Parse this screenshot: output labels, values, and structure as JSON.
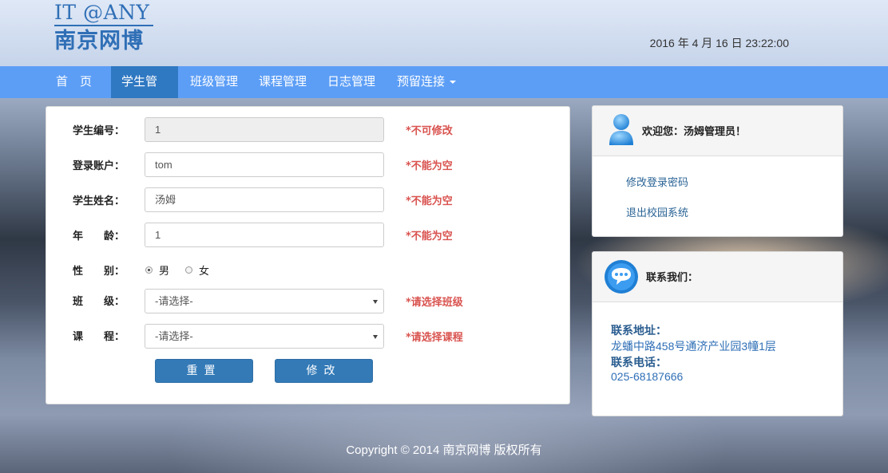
{
  "header": {
    "logo_top": "IT @ANY",
    "logo_bottom": "南京网博",
    "datetime": "2016 年 4 月 16 日 23:22:00"
  },
  "nav": {
    "items": [
      {
        "label": "首　页"
      },
      {
        "label": "学生管理"
      },
      {
        "label": "班级管理"
      },
      {
        "label": "课程管理"
      },
      {
        "label": "日志管理"
      },
      {
        "label": "预留连接"
      }
    ],
    "active": "学生管理"
  },
  "form": {
    "fields": [
      {
        "label": "学生编号：",
        "value": "1",
        "hint": "*不可修改"
      },
      {
        "label": "登录账户：",
        "value": "tom",
        "hint": "*不能为空"
      },
      {
        "label": "学生姓名：",
        "value": "汤姆",
        "hint": "*不能为空"
      },
      {
        "label": "年　　龄：",
        "value": "1",
        "hint": "*不能为空"
      }
    ],
    "gender": {
      "label": "性　　别：",
      "options": [
        "男",
        "女"
      ],
      "selected": "男"
    },
    "class": {
      "label": "班　　级：",
      "value": "-请选择-",
      "hint": "*请选择班级"
    },
    "course": {
      "label": "课　　程：",
      "value": "-请选择-",
      "hint": "*请选择课程"
    },
    "reset_label": "重置",
    "submit_label": "修改"
  },
  "welcome": {
    "title": "欢迎您：汤姆管理员！",
    "links": [
      "修改登录密码",
      "退出校园系统"
    ]
  },
  "contact": {
    "title": "联系我们：",
    "address_label": "联系地址：",
    "address": "龙蟠中路458号通济产业园3幢1层",
    "phone_label": "联系电话：",
    "phone": "025-68187666"
  },
  "footer": {
    "copyright": "Copyright © 2014 南京网博 版权所有"
  },
  "colors": {
    "nav": "#5c9ef6",
    "nav_active": "#2f78c2",
    "button": "#337ab7",
    "hint": "#d9534f",
    "brand": "#2f6fb6"
  }
}
